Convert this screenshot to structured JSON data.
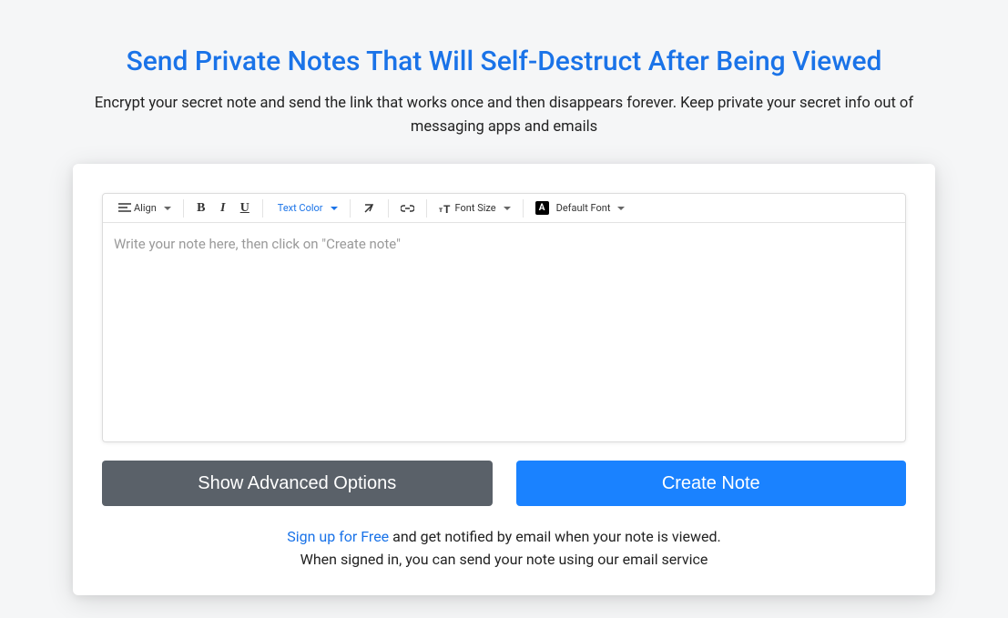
{
  "header": {
    "title": "Send Private Notes That Will Self-Destruct After Being Viewed",
    "subtitle": "Encrypt your secret note and send the link that works once and then disappears forever. Keep private your secret info out of messaging apps and emails"
  },
  "toolbar": {
    "align_label": "Align",
    "bold_letter": "B",
    "italic_letter": "I",
    "underline_letter": "U",
    "textcolor_label": "Text Color",
    "fontsize_label": "Font Size",
    "defaultfont_label": "Default Font",
    "fontbadge_letter": "A"
  },
  "editor": {
    "placeholder": "Write your note here, then click on \"Create note\""
  },
  "buttons": {
    "advanced": "Show Advanced Options",
    "create": "Create Note"
  },
  "footer": {
    "signup_text": "Sign up for Free",
    "rest1": " and get notified by email when your note is viewed.",
    "line2": "When signed in, you can send your note using our email service"
  }
}
